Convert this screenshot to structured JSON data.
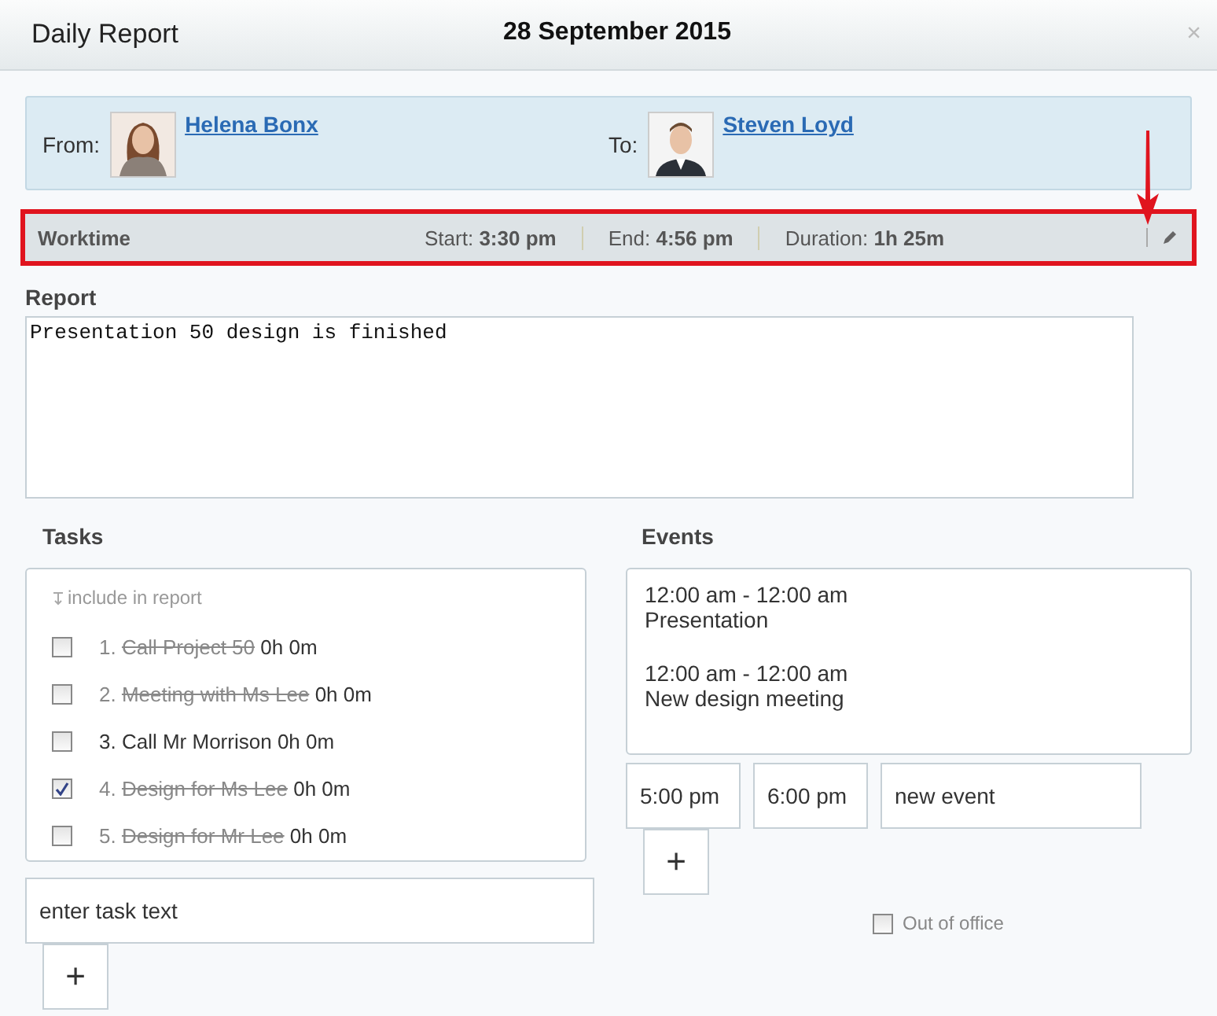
{
  "window": {
    "title": "Daily Report",
    "date": "28 September 2015",
    "close": "×"
  },
  "sender": {
    "from_label": "From:",
    "from_name": "Helena Bonx",
    "to_label": "To:",
    "to_name": "Steven Loyd"
  },
  "worktime": {
    "label": "Worktime",
    "highlighted": true,
    "start_label": "Start:",
    "start": "3:30 pm",
    "end_label": "End:",
    "end": "4:56 pm",
    "duration_label": "Duration:",
    "duration": "1h 25m"
  },
  "report": {
    "label": "Report",
    "value": "Presentation 50 design is finished"
  },
  "tasks": {
    "label": "Tasks",
    "hint": "include in report",
    "items": [
      {
        "number": "1.",
        "text": "Call Project 50",
        "time": "0h 0m",
        "checked": false,
        "done": true
      },
      {
        "number": "2.",
        "text": "Meeting with Ms Lee",
        "time": "0h 0m",
        "checked": false,
        "done": true
      },
      {
        "number": "3.",
        "text": "Call Mr Morrison",
        "time": "0h 0m",
        "checked": false,
        "done": false
      },
      {
        "number": "4.",
        "text": "Design for Ms Lee",
        "time": "0h 0m",
        "checked": true,
        "done": true
      },
      {
        "number": "5.",
        "text": "Design for Mr Lee",
        "time": "0h 0m",
        "checked": false,
        "done": true
      }
    ],
    "new_task": {
      "placeholder": "enter task text"
    },
    "add": "+"
  },
  "events": {
    "label": "Events",
    "items": [
      {
        "start": "12:00 am",
        "separator": "-",
        "end": "12:00 am",
        "title": "Presentation"
      },
      {
        "start": "12:00 am",
        "separator": "-",
        "end": "12:00 am",
        "title": "New design meeting"
      }
    ],
    "new_event": {
      "start": "5:00 pm",
      "end": "6:00 pm",
      "title": "new event"
    },
    "add": "+",
    "out_of_office": {
      "label": "Out of office",
      "checked": false
    }
  }
}
